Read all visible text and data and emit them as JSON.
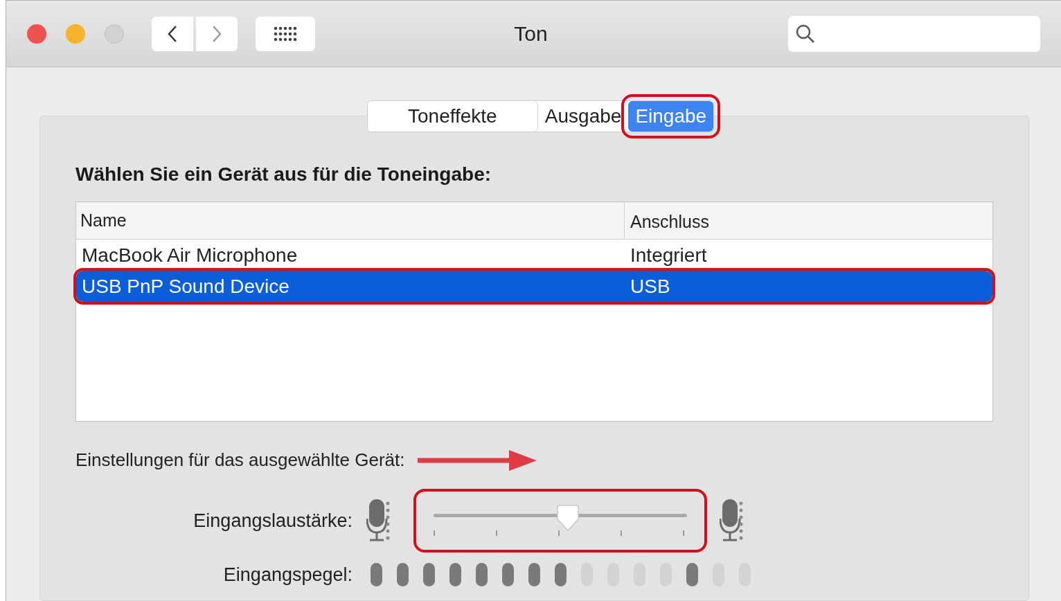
{
  "window": {
    "title": "Ton"
  },
  "tabs": [
    {
      "label": "Toneffekte",
      "selected": false,
      "highlighted": false
    },
    {
      "label": "Ausgabe",
      "selected": false,
      "highlighted": false
    },
    {
      "label": "Eingabe",
      "selected": true,
      "highlighted": true
    }
  ],
  "device_heading": "Wählen Sie ein Gerät aus für die Toneingabe:",
  "table": {
    "columns": [
      "Name",
      "Anschluss"
    ],
    "rows": [
      {
        "cells": [
          "MacBook Air Microphone",
          "Integriert"
        ],
        "selected": false,
        "highlighted": false
      },
      {
        "cells": [
          "USB PnP Sound Device",
          "USB"
        ],
        "selected": true,
        "highlighted": true
      }
    ]
  },
  "settings": {
    "heading": "Einstellungen für das ausgewählte Gerät:",
    "annotation_arrow": true,
    "input_volume": {
      "label": "Eingangslaustärke:",
      "level": 0.53,
      "highlighted": true
    },
    "input_level": {
      "label": "Eingangspegel:",
      "segments": [
        {
          "lit": true
        },
        {
          "lit": true
        },
        {
          "lit": true
        },
        {
          "lit": true
        },
        {
          "lit": true
        },
        {
          "lit": true
        },
        {
          "lit": true
        },
        {
          "lit": true
        },
        {
          "lit": false
        },
        {
          "lit": false
        },
        {
          "lit": false
        },
        {
          "lit": false
        },
        {
          "lit": true
        },
        {
          "lit": false
        },
        {
          "lit": false
        }
      ]
    }
  }
}
